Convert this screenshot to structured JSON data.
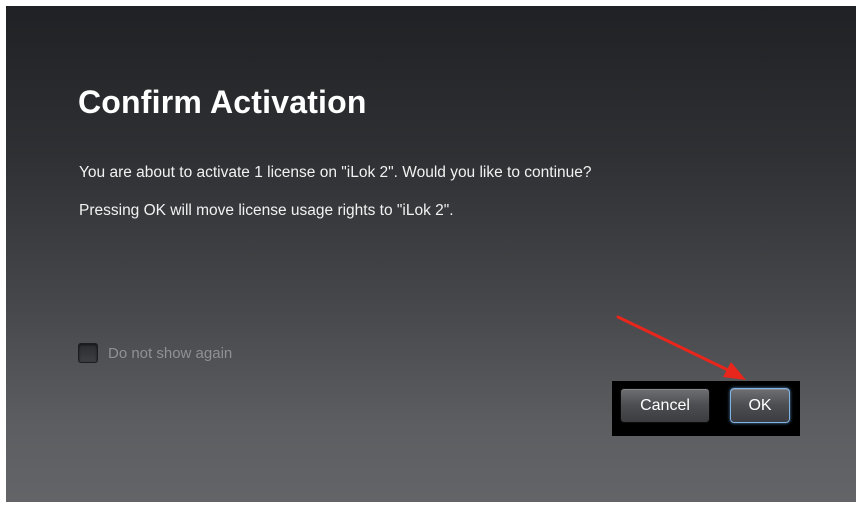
{
  "dialog": {
    "title": "Confirm Activation",
    "message_line1": "You are about to activate 1 license on \"iLok 2\". Would you like to continue?",
    "message_line2": "Pressing OK will move license usage rights to \"iLok 2\".",
    "do_not_show_label": "Do not show again",
    "do_not_show_checked": false,
    "buttons": {
      "cancel_label": "Cancel",
      "ok_label": "OK"
    }
  },
  "annotation": {
    "arrow_color": "#e8261c",
    "points_to": "ok-button"
  }
}
